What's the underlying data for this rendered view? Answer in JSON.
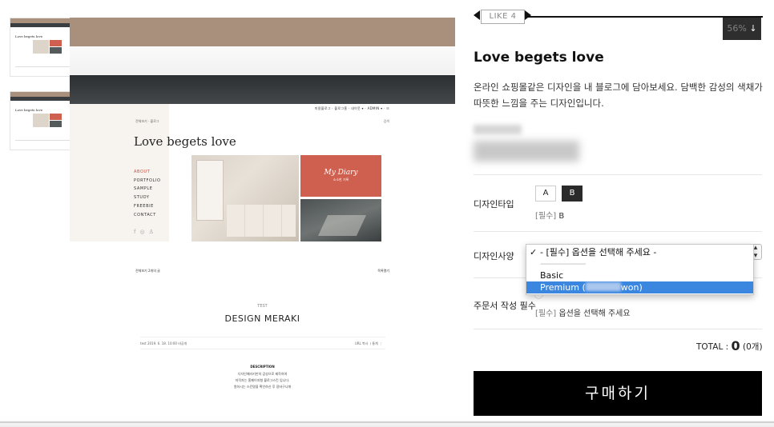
{
  "preview": {
    "topnav": "미용블로그 · 블로그홈 · 내이웃 ▾ · ADMIN ▾ · ☷",
    "breadcrumb": "전체보기 · 블로그",
    "right_small": "검색",
    "big_title": "Love begets love",
    "menu": [
      "ABOUT",
      "PORTFOLIO",
      "SAMPLE",
      "STUDY",
      "FREEBIE",
      "CONTACT"
    ],
    "diary_title": "My Diary",
    "diary_sub": "소소한 기록",
    "list_head": "전체보기 2개의 글",
    "list_right": "목록열기",
    "post_category": "TEST",
    "post_title": "DESIGN MERAKI",
    "post_meta": "test  2019. 6. 18. 10:00  비공개",
    "post_meta_right": "URL 복사   ㅣ통계  ⋮",
    "desc_heading": "DESCRIPTION",
    "desc_lines": [
      "디자인메라키만의 감성으로 제작하여",
      "저작자는 홈페이지형 블로그스킨 입니다.",
      "원하시는 스킨명을 확인하신 후 장바구니에"
    ]
  },
  "thumbs": [
    {
      "title": "Love begets love"
    },
    {
      "title": "Love begets love"
    }
  ],
  "like": {
    "label": "LIKE",
    "count": "4"
  },
  "zoom": {
    "value": "56%",
    "arrow": "↓"
  },
  "product": {
    "title": "Love begets love",
    "description": "온라인 쇼핑몰같은 디자인을 내 블로그에 담아보세요. 담백한 감성의 색채가 따뜻한 느낌을 주는 디자인입니다."
  },
  "options": {
    "design_type": {
      "label": "디자인타입",
      "buttons": [
        "A",
        "B"
      ],
      "selected_note_req": "[필수]",
      "selected_note_val": "B"
    },
    "design_spec": {
      "label": "디자인사양",
      "dropdown_items": {
        "placeholder": "- [필수] 옵션을 선택해 주세요 -",
        "separator": "-------------------",
        "basic": "Basic",
        "premium_prefix": "Premium (",
        "premium_suffix": "won)"
      }
    },
    "order_note": {
      "label": "주문서 작성 필수",
      "note_req": "[필수]",
      "note_val": "옵션을 선택해 주세요"
    }
  },
  "total": {
    "label": "TOTAL :",
    "value": "0",
    "count": "(0개)"
  },
  "buy_label": "구매하기",
  "colors": {
    "accent": "#000000",
    "highlight": "#3b87e0",
    "diary": "#cf5f4e",
    "tan": "#a8907c"
  }
}
